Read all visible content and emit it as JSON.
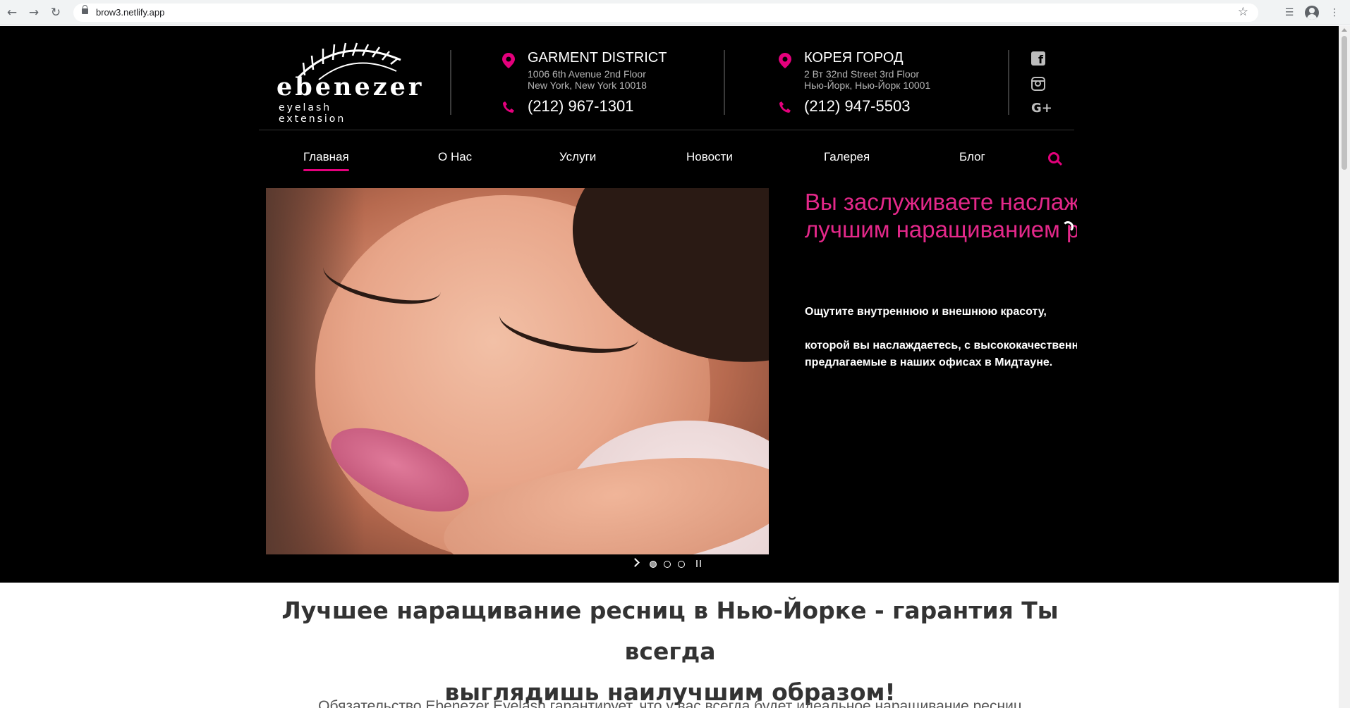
{
  "browser": {
    "url": "brow3.netlify.app"
  },
  "header": {
    "logo": {
      "word": "ebenezer",
      "sub": "eyelash extension"
    },
    "locations": [
      {
        "title": "GARMENT DISTRICT",
        "address_line1": "1006 6th Avenue 2nd Floor",
        "address_line2": "New York, New York 10018",
        "phone": "(212) 967-1301"
      },
      {
        "title": "КОРЕЯ ГОРОД",
        "address_line1": "2 Вт 32nd Street 3rd Floor",
        "address_line2": "Нью-Йорк, Нью-Йорк 10001",
        "phone": "(212) 947-5503"
      }
    ],
    "social": {
      "facebook": "f",
      "googleplus": "G+"
    }
  },
  "nav": {
    "items": [
      "Главная",
      "О Нас",
      "Услуги",
      "Новости",
      "Галерея",
      "Блог"
    ]
  },
  "slider": {
    "heading_line1": "Вы заслуживаете наслаж",
    "heading_line2": "лучшим наращиванием р",
    "para1": "Ощутите внутреннюю и внешнюю красоту,",
    "para2_line1": "которой вы наслаждаетесь, с высококачественн",
    "para2_line2": "предлагаемые в наших офисах в Мидтауне."
  },
  "main": {
    "headline_line1": "Лучшее наращивание ресниц в Нью-Йорке - гарантия Ты всегда",
    "headline_line2": "выглядишь наилучшим образом!",
    "subline": "Обязательство Ebenezer Eyelash гарантирует, что у вас всегда будет идеальное наращивание ресниц"
  },
  "colors": {
    "accent": "#e4007c",
    "heading_pink": "#e4288a",
    "hero_bg": "#000000"
  }
}
